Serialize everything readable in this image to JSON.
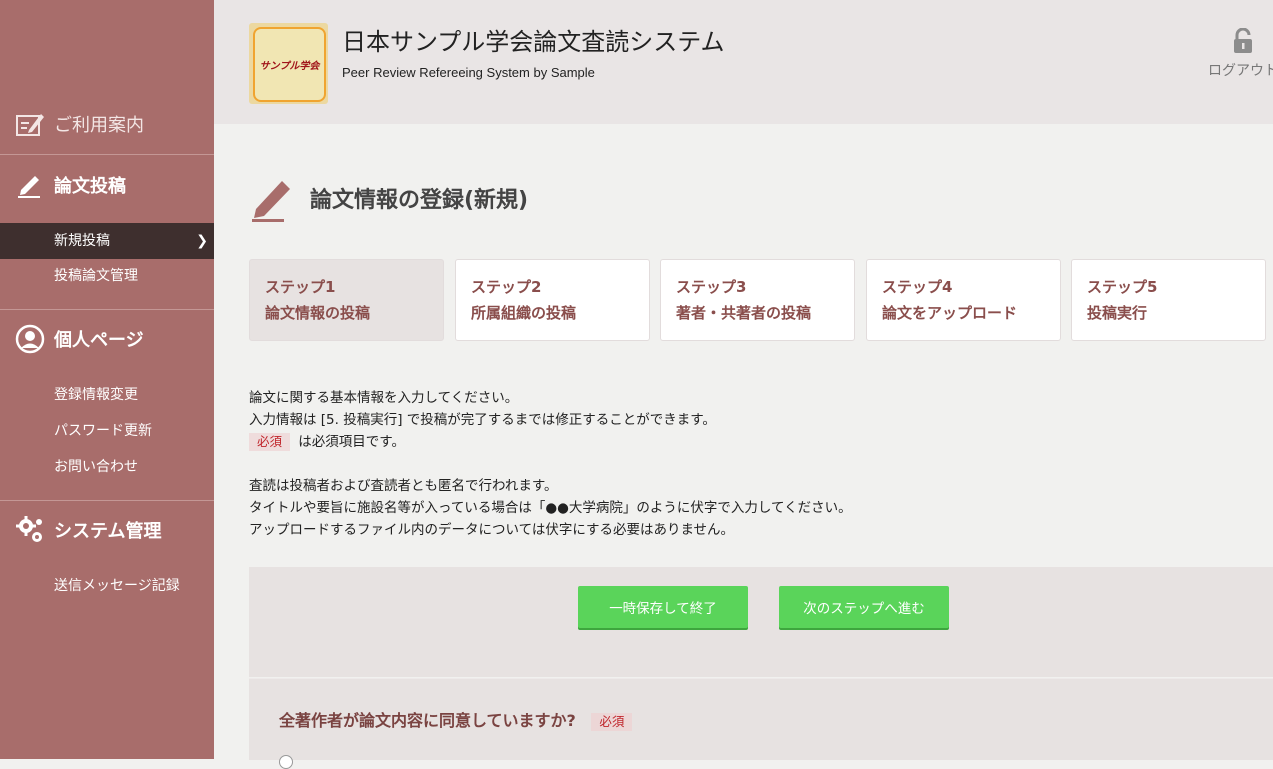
{
  "header": {
    "logo_text": "サンプル学会",
    "title": "日本サンプル学会論文査読システム",
    "subtitle": "Peer Review Refereeing System by Sample",
    "logout_label": "ログアウト"
  },
  "sidebar": {
    "guide": {
      "label": "ご利用案内",
      "icon": "clipboard-icon"
    },
    "submit": {
      "label": "論文投稿",
      "icon": "pencil-icon",
      "items": [
        {
          "label": "新規投稿",
          "active": true
        },
        {
          "label": "投稿論文管理"
        }
      ]
    },
    "personal": {
      "label": "個人ページ",
      "icon": "user-circle-icon",
      "items": [
        {
          "label": "登録情報変更"
        },
        {
          "label": "パスワード更新"
        },
        {
          "label": "お問い合わせ"
        }
      ]
    },
    "system": {
      "label": "システム管理",
      "icon": "gears-icon",
      "items": [
        {
          "label": "送信メッセージ記録"
        }
      ]
    }
  },
  "page": {
    "title": "論文情報の登録(新規)"
  },
  "steps": [
    {
      "num": "ステップ1",
      "label": "論文情報の投稿",
      "current": true
    },
    {
      "num": "ステップ2",
      "label": "所属組織の投稿"
    },
    {
      "num": "ステップ3",
      "label": "著者・共著者の投稿"
    },
    {
      "num": "ステップ4",
      "label": "論文をアップロード"
    },
    {
      "num": "ステップ5",
      "label": "投稿実行"
    }
  ],
  "intro": {
    "line1": "論文に関する基本情報を入力してください。",
    "line2": "入力情報は [5. 投稿実行] で投稿が完了するまでは修正することができます。",
    "required_badge": "必須",
    "line3_suffix": " は必須項目です。",
    "line4": "査読は投稿者および査読者とも匿名で行われます。",
    "line5": "タイトルや要旨に施設名等が入っている場合は「●●大学病院」のように伏字で入力してください。",
    "line6": "アップロードするファイル内のデータについては伏字にする必要はありません。"
  },
  "actions": {
    "save_label": "一時保存して終了",
    "next_label": "次のステップへ進む"
  },
  "question": {
    "text": "全著作者が論文内容に同意していますか?",
    "required_badge": "必須"
  },
  "colors": {
    "sidebar_bg": "#a86d6b",
    "active_item_bg": "#3e2f2e",
    "button_green": "#5ad45a",
    "step_text": "#8a4e4c"
  }
}
